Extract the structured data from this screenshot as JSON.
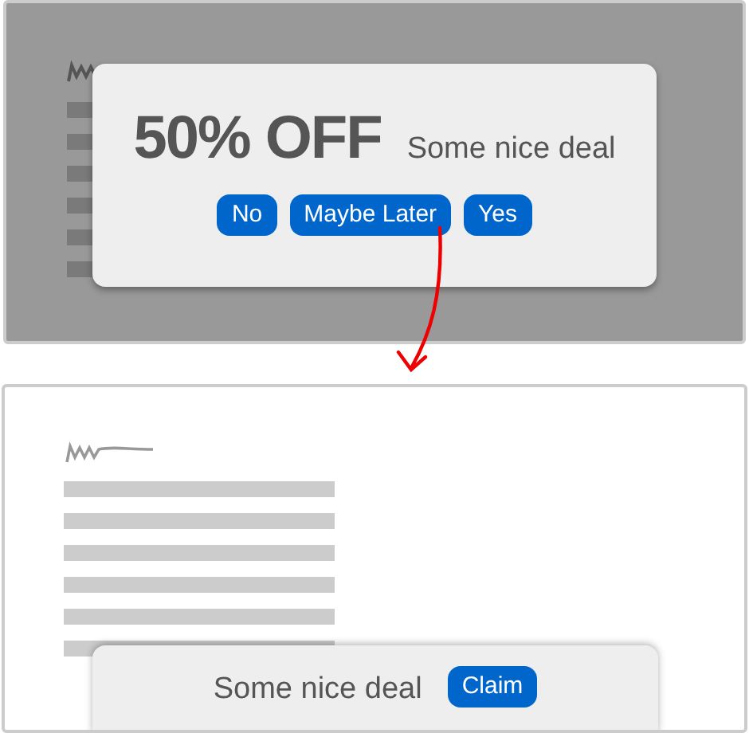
{
  "before": {
    "dimmed": true,
    "headline": "50% OFF",
    "message": "Some nice deal",
    "buttons": [
      "No",
      "Maybe Later",
      "Yes"
    ]
  },
  "after": {
    "message": "Some nice deal",
    "button": "Claim"
  }
}
